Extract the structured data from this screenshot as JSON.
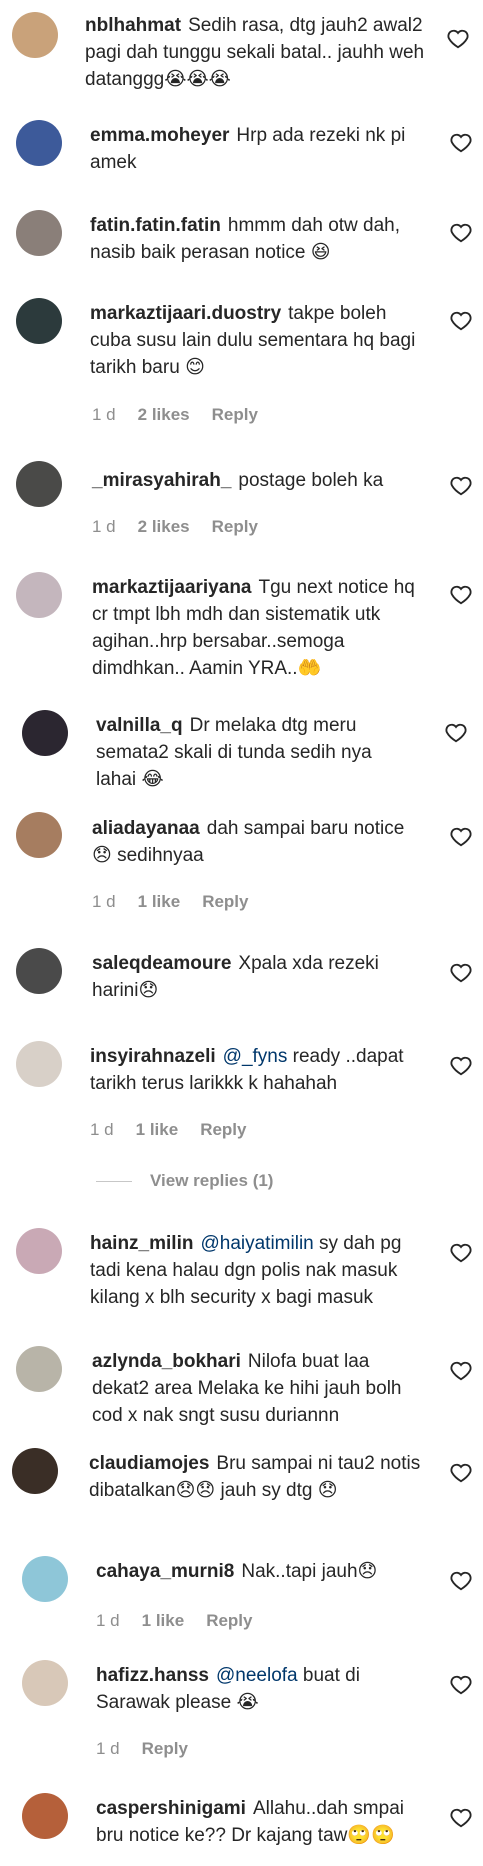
{
  "comments": [
    {
      "user": "nblhahmat",
      "text": "Sedih rasa, dtg jauh2 awal2 pagi dah tunggu sekali batal.. jauhh weh datanggg",
      "emoji": "😭😭😭",
      "avatar_color": "#c9a27a"
    },
    {
      "user": "emma.moheyer",
      "text": "Hrp ada rezeki nk pi amek",
      "avatar_color": "#3d5a9a"
    },
    {
      "user": "fatin.fatin.fatin",
      "text": "hmmm dah otw dah, nasib baik perasan notice",
      "emoji": "😆",
      "avatar_color": "#8a7f79"
    },
    {
      "user": "markaztijaari.duostry",
      "text": "takpe boleh cuba susu lain dulu sementara hq bagi tarikh baru",
      "emoji": "😊",
      "avatar_color": "#2c3a3c",
      "time": "1 d",
      "likes": "2 likes",
      "reply": "Reply"
    },
    {
      "user": "_mirasyahirah_",
      "text": "postage boleh ka",
      "avatar_color": "#4a4a48",
      "time": "1 d",
      "likes": "2 likes",
      "reply": "Reply"
    },
    {
      "user": "markaztijaariyana",
      "text": "Tgu next notice hq cr tmpt lbh mdh dan sistematik utk agihan..hrp bersabar..semoga dimdhkan.. Aamin YRA..",
      "emoji": "🤲",
      "avatar_color": "#c4b6bd"
    },
    {
      "user": "valnilla_q",
      "text": "Dr melaka dtg meru semata2 skali di tunda sedih nya lahai",
      "emoji": "😂",
      "avatar_color": "#2b2630"
    },
    {
      "user": "aliadayanaa",
      "text": "dah sampai baru notice",
      "emoji": "😞",
      "text2": "sedihnyaa",
      "avatar_color": "#a67d60",
      "time": "1 d",
      "likes": "1 like",
      "reply": "Reply"
    },
    {
      "user": "saleqdeamoure",
      "text": "Xpala xda rezeki harini",
      "emoji": "😞",
      "avatar_color": "#4a4a4a"
    },
    {
      "user": "insyirahnazeli",
      "mention": "@_fyns",
      "text": "ready ..dapat tarikh terus larikkk k hahahah",
      "avatar_color": "#d8d0c8",
      "time": "1 d",
      "likes": "1 like",
      "reply": "Reply",
      "view_replies": "View replies (1)"
    },
    {
      "user": "hainz_milin",
      "mention": "@haiyatimilin",
      "text": "sy dah pg tadi kena halau dgn polis nak masuk kilang x blh security x bagi masuk",
      "avatar_color": "#c9a9b5"
    },
    {
      "user": "azlynda_bokhari",
      "text": "Nilofa buat laa dekat2 area Melaka ke hihi jauh bolh cod x nak sngt susu duriannn",
      "avatar_color": "#b8b4a8"
    },
    {
      "user": "claudiamojes",
      "text": "Bru sampai ni tau2 notis dibatalkan",
      "emoji": "😞😞",
      "text2": "jauh sy dtg",
      "emoji2": "😞",
      "avatar_color": "#3a2e26"
    },
    {
      "user": "cahaya_murni8",
      "text": "Nak..tapi jauh",
      "emoji": "😞",
      "avatar_color": "#8ec6d8",
      "time": "1 d",
      "likes": "1 like",
      "reply": "Reply"
    },
    {
      "user": "hafizz.hanss",
      "mention": "@neelofa",
      "text": "buat di Sarawak please",
      "emoji": "😭",
      "avatar_color": "#d8c8b8",
      "time": "1 d",
      "reply": "Reply"
    },
    {
      "user": "caspershinigami",
      "text": "Allahu..dah smpai bru notice ke?? Dr kajang taw",
      "emoji": "🙄🙄",
      "avatar_color": "#b5603a"
    }
  ]
}
